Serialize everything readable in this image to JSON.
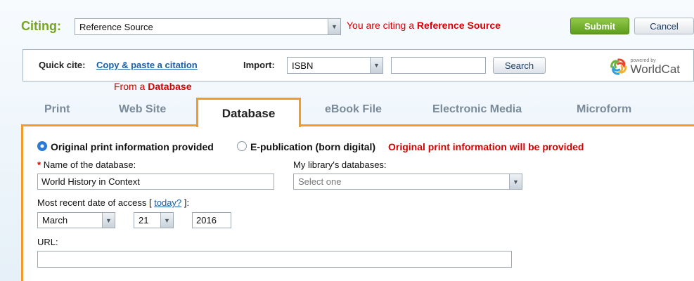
{
  "citing": {
    "label": "Citing:",
    "selected": "Reference Source",
    "note_prefix": "You are citing a ",
    "note_emphasis": "Reference Source"
  },
  "actions": {
    "submit": "Submit",
    "cancel": "Cancel"
  },
  "quick_cite": {
    "label": "Quick cite:",
    "link": "Copy & paste a citation",
    "import_label": "Import:",
    "import_selected": "ISBN",
    "import_value": "",
    "search_button": "Search",
    "logo_small": "powered by",
    "logo_name": "WorldCat"
  },
  "source_note": {
    "prefix": "From a ",
    "emphasis": "Database"
  },
  "tabs": [
    {
      "label": "Print",
      "active": false
    },
    {
      "label": "Web Site",
      "active": false
    },
    {
      "label": "Database",
      "active": true
    },
    {
      "label": "eBook File",
      "active": false
    },
    {
      "label": "Electronic Media",
      "active": false
    },
    {
      "label": "Microform",
      "active": false
    }
  ],
  "form": {
    "radio_original": {
      "label": "Original print information provided",
      "checked": true
    },
    "radio_epub": {
      "label": "E-publication (born digital)",
      "checked": false
    },
    "print_note": "Original print information will be provided",
    "database_name": {
      "required_mark": "*",
      "label": "Name of the database:",
      "value": "World History in Context"
    },
    "my_databases": {
      "label": "My library's databases:",
      "placeholder": "Select one"
    },
    "access_date": {
      "label_before": "Most recent date of access [ ",
      "today_link": "today?",
      "label_after": " ]:",
      "month": "March",
      "day": "21",
      "year": "2016"
    },
    "url": {
      "label": "URL:",
      "value": ""
    }
  },
  "colors": {
    "brand_green": "#77a51f",
    "accent_orange": "#f39a2b",
    "notice_red": "#d60000",
    "link_blue": "#1c5fa8"
  }
}
